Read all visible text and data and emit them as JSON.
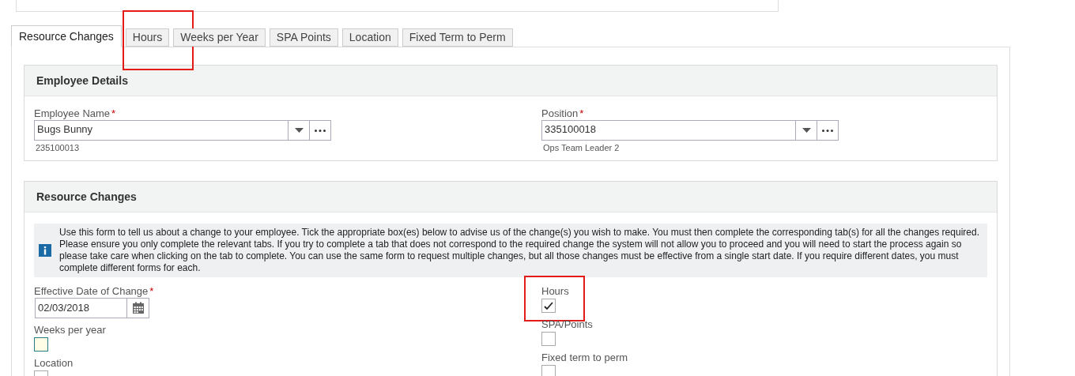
{
  "tabs": [
    {
      "label": "Resource Changes",
      "selected": true,
      "highlighted": false
    },
    {
      "label": "Hours",
      "selected": false,
      "highlighted": true
    },
    {
      "label": "Weeks per Year",
      "selected": false,
      "highlighted": false
    },
    {
      "label": "SPA Points",
      "selected": false,
      "highlighted": false
    },
    {
      "label": "Location",
      "selected": false,
      "highlighted": false
    },
    {
      "label": "Fixed Term to Perm",
      "selected": false,
      "highlighted": false
    }
  ],
  "employee_details": {
    "title": "Employee Details",
    "fields": [
      {
        "label": "Employee Name",
        "required_mark": "*",
        "value": "Bugs Bunny",
        "hint": "235100013"
      },
      {
        "label": "Position",
        "required_mark": "*",
        "value": "335100018",
        "hint": "Ops Team Leader 2"
      }
    ]
  },
  "resource_changes": {
    "title": "Resource Changes",
    "info": "Use this form to tell us about a change to your employee. Tick the appropriate box(es) below to advise us of the change(s) you wish to make. You must then complete the corresponding tab(s) for all the changes required. Please ensure you only complete the relevant tabs. If you try to complete a tab that does not correspond to the required change the system will not allow you to proceed and you will need to start the process again so please take care when clicking on the tab to complete. You can use the same form to request multiple changes, but all those changes must be effective from a single start date. If you require different dates, you must complete different forms for each.",
    "date_field": {
      "label": "Effective Date of Change",
      "required_mark": "*",
      "value": "02/03/2018"
    },
    "options": [
      {
        "label": "Hours",
        "checked": true,
        "focused": false,
        "highlighted": true
      },
      {
        "label": "Weeks per year",
        "checked": false,
        "focused": true,
        "highlighted": false
      },
      {
        "label": "SPA/Points",
        "checked": false,
        "focused": false,
        "highlighted": false
      },
      {
        "label": "Location",
        "checked": false,
        "focused": false,
        "highlighted": false
      },
      {
        "label": "Fixed term to perm",
        "checked": false,
        "focused": false,
        "highlighted": false
      }
    ]
  }
}
